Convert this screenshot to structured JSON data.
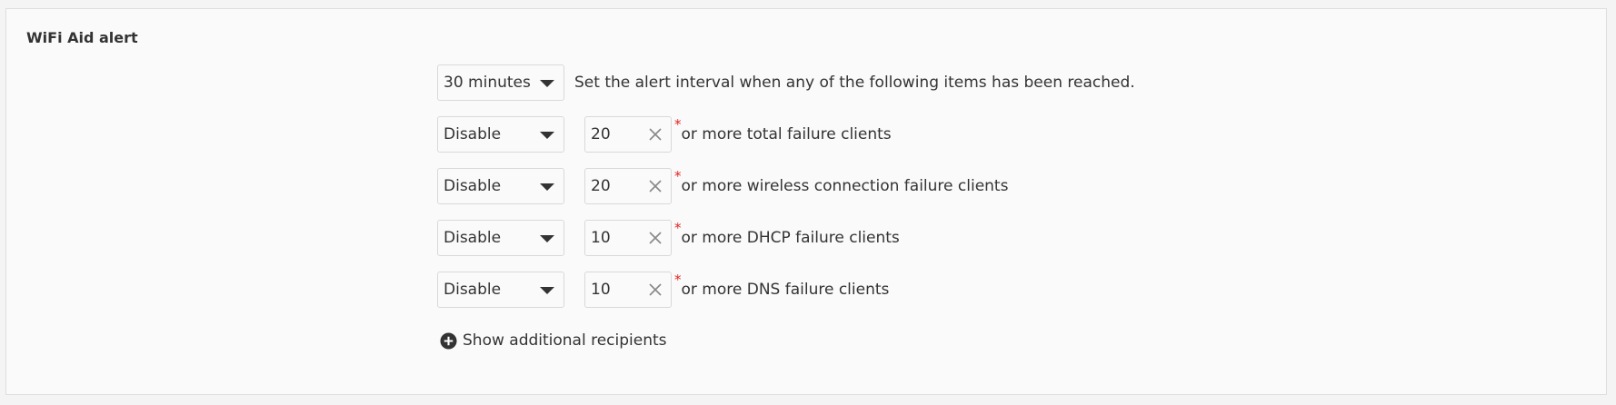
{
  "section": {
    "title": "WiFi Aid alert"
  },
  "interval": {
    "selected": "30 minutes",
    "description": "Set the alert interval when any of the following items has been reached."
  },
  "rules": [
    {
      "mode": "Disable",
      "value": "20",
      "required_mark": "*",
      "label": "or more total failure clients"
    },
    {
      "mode": "Disable",
      "value": "20",
      "required_mark": "*",
      "label": "or more wireless connection failure clients"
    },
    {
      "mode": "Disable",
      "value": "10",
      "required_mark": "*",
      "label": "or more DHCP failure clients"
    },
    {
      "mode": "Disable",
      "value": "10",
      "required_mark": "*",
      "label": "or more DNS failure clients"
    }
  ],
  "additional": {
    "label": "Show additional recipients",
    "icon": "plus-circle-icon"
  },
  "colors": {
    "required": "#e02424",
    "text": "#333333",
    "border": "#d9d9d9",
    "panel_bg": "#fafafa"
  }
}
